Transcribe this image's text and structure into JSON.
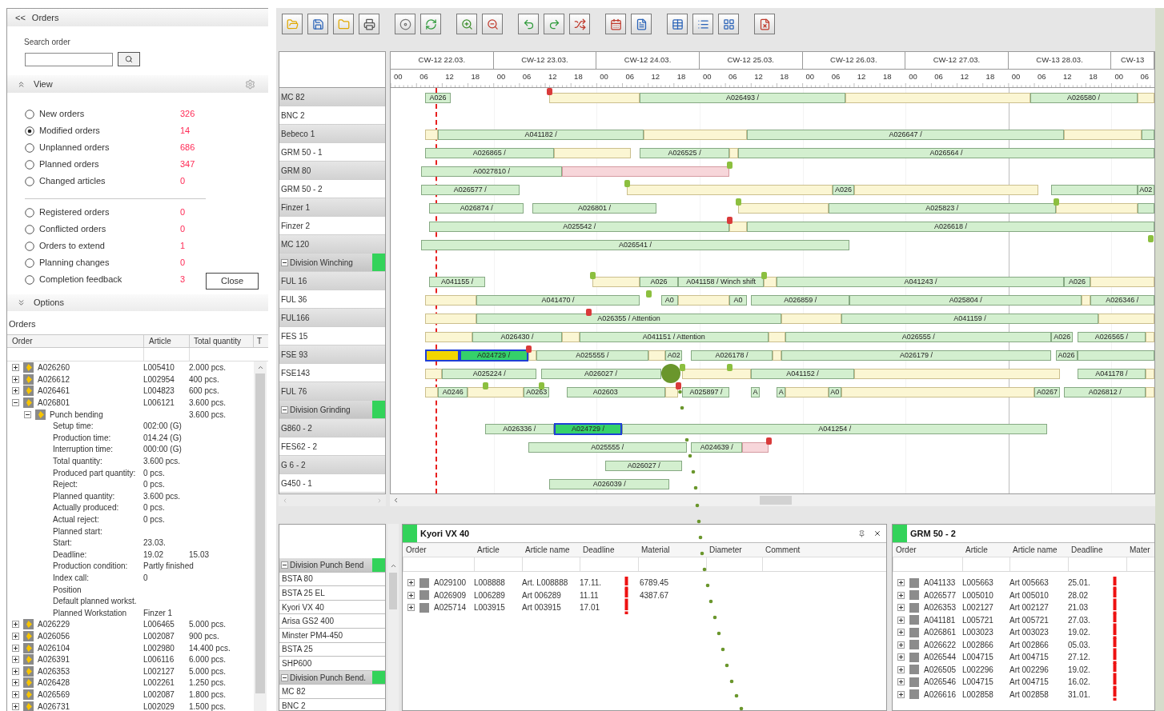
{
  "orders_panel": {
    "collapse": "<<",
    "title": "Orders",
    "search_label": "Search order",
    "view_title": "View",
    "filters": [
      {
        "label": "New orders",
        "count": "326",
        "selected": false
      },
      {
        "label": "Modified orders",
        "count": "14",
        "selected": true
      },
      {
        "label": "Unplanned orders",
        "count": "686",
        "selected": false
      },
      {
        "label": "Planned orders",
        "count": "347",
        "selected": false
      },
      {
        "label": "Changed articles",
        "count": "0",
        "selected": false
      }
    ],
    "more_filters": [
      {
        "label": "Registered orders",
        "count": "0",
        "selected": false
      },
      {
        "label": "Conflicted orders",
        "count": "0",
        "selected": false
      },
      {
        "label": "Orders to extend",
        "count": "1",
        "selected": false
      },
      {
        "label": "Planning changes",
        "count": "0",
        "selected": false
      },
      {
        "label": "Completion feedback",
        "count": "3",
        "selected": false
      }
    ],
    "close_button": "Close",
    "options_title": "Options",
    "orders_title": "Orders",
    "columns": [
      "Order",
      "Article",
      "Total quantity",
      "T"
    ],
    "orders": [
      {
        "order": "A026260",
        "article": "L005410",
        "quantity": "2.000 pcs.",
        "expanded": false
      },
      {
        "order": "A026612",
        "article": "L002954",
        "quantity": "400 pcs.",
        "expanded": false
      },
      {
        "order": "A026461",
        "article": "L004823",
        "quantity": "600 pcs.",
        "expanded": false
      },
      {
        "order": "A026801",
        "article": "L006121",
        "quantity": "3.600 pcs.",
        "expanded": true,
        "operations": [
          {
            "name": "Punch bending",
            "quantity": "3.600 pcs.",
            "expanded": true,
            "details": [
              {
                "label": "Setup time:",
                "values": [
                  "002:00 (G)"
                ]
              },
              {
                "label": "Production time:",
                "values": [
                  "014.24 (G)"
                ]
              },
              {
                "label": "Interruption time:",
                "values": [
                  "000:00 (G)"
                ]
              },
              {
                "label": "Total quantity:",
                "values": [
                  "3.600 pcs."
                ]
              },
              {
                "label": "Produced part quantity:",
                "values": [
                  "0 pcs."
                ]
              },
              {
                "label": "Reject:",
                "values": [
                  "0 pcs."
                ]
              },
              {
                "label": "Planned quantity:",
                "values": [
                  "3.600 pcs."
                ]
              },
              {
                "label": "Actually produced:",
                "values": [
                  "0 pcs."
                ]
              },
              {
                "label": "Actual reject:",
                "values": [
                  "0 pcs."
                ]
              },
              {
                "label": "Planned start:"
              },
              {
                "label": "Start:",
                "values": [
                  "23.03."
                ]
              },
              {
                "label": "Deadline:",
                "values": [
                  "19.02",
                  "15.03"
                ]
              },
              {
                "label": "Production condition:",
                "values": [
                  "Partly finished"
                ]
              },
              {
                "label": "Index call:",
                "values": [
                  "0"
                ]
              },
              {
                "label": "Position"
              },
              {
                "label": "Default planned workst."
              },
              {
                "label": "Planned Workstation",
                "values": [
                  "Finzer 1"
                ]
              }
            ]
          }
        ]
      },
      {
        "order": "A026229",
        "article": "L006465",
        "quantity": "5.000 pcs.",
        "expanded": false
      },
      {
        "order": "A026056",
        "article": "L002087",
        "quantity": "900 pcs.",
        "expanded": false
      },
      {
        "order": "A026104",
        "article": "L002980",
        "quantity": "14.400 pcs.",
        "expanded": false
      },
      {
        "order": "A026391",
        "article": "L006116",
        "quantity": "6.000 pcs.",
        "expanded": false
      },
      {
        "order": "A026353",
        "article": "L002127",
        "quantity": "5.000 pcs.",
        "expanded": false
      },
      {
        "order": "A026428",
        "article": "L002261",
        "quantity": "1.250 pcs.",
        "expanded": false
      },
      {
        "order": "A026569",
        "article": "L002087",
        "quantity": "1.800 pcs.",
        "expanded": false
      },
      {
        "order": "A026731",
        "article": "L002029",
        "quantity": "1.500 pcs.",
        "expanded": false
      }
    ]
  },
  "gantt": {
    "days": [
      {
        "week": "CW-12 22.03.",
        "hours": [
          "00",
          "06",
          "12",
          "18"
        ]
      },
      {
        "week": "CW-12 23.03.",
        "hours": [
          "00",
          "06",
          "12",
          "18"
        ]
      },
      {
        "week": "CW-12 24.03.",
        "hours": [
          "00",
          "06",
          "12",
          "18"
        ]
      },
      {
        "week": "CW-12 25.03.",
        "hours": [
          "00",
          "06",
          "12",
          "18"
        ]
      },
      {
        "week": "CW-12 26.03.",
        "hours": [
          "00",
          "06",
          "12",
          "18"
        ]
      },
      {
        "week": "CW-12 27.03.",
        "hours": [
          "00",
          "06",
          "12",
          "18"
        ]
      },
      {
        "week": "CW-13 28.03.",
        "hours": [
          "00",
          "06",
          "12",
          "18"
        ]
      },
      {
        "week": "CW-13",
        "hours": [
          "00",
          "06"
        ]
      }
    ],
    "rows": [
      {
        "kind": "resource",
        "name": "MC 82",
        "flags": [
          {
            "color": "#d93a3a"
          }
        ],
        "bars": [
          {
            "label": "A026",
            "kind": "planned"
          },
          {
            "kind": "buffer"
          },
          {
            "label": "A026493 /",
            "kind": "planned"
          },
          {
            "kind": "buffer"
          },
          {
            "label": "A026580 /",
            "kind": "planned"
          },
          {
            "kind": "buffer"
          }
        ]
      },
      {
        "kind": "resource",
        "name": "BNC 2"
      },
      {
        "kind": "resource",
        "name": "Bebeco 1",
        "bars": [
          {
            "kind": "buffer"
          },
          {
            "label": "A041182 /",
            "kind": "planned"
          },
          {
            "kind": "buffer"
          },
          {
            "label": "A026647 /",
            "kind": "planned"
          },
          {
            "kind": "buffer"
          },
          {
            "kind": "planned"
          }
        ]
      },
      {
        "kind": "resource",
        "name": "GRM 50 - 1",
        "bars": [
          {
            "label": "A026865 /",
            "kind": "planned"
          },
          {
            "kind": "buffer"
          },
          {
            "label": "A026525 /",
            "kind": "planned"
          },
          {
            "kind": "buffer"
          },
          {
            "label": "A026564 /",
            "kind": "planned"
          }
        ]
      },
      {
        "kind": "resource",
        "name": "GRM 80",
        "flags": [
          {
            "color": "#8cbf3f"
          }
        ],
        "bars": [
          {
            "label": "A0027810 /",
            "kind": "planned"
          },
          {
            "kind": "late"
          }
        ]
      },
      {
        "kind": "resource",
        "name": "GRM 50 - 2",
        "flags": [
          {
            "color": "#8cbf3f"
          }
        ],
        "bars": [
          {
            "label": "A026577 /",
            "kind": "planned"
          },
          {
            "kind": "buffer"
          },
          {
            "label": "A026",
            "kind": "planned"
          },
          {
            "kind": "buffer"
          },
          {
            "kind": "planned"
          },
          {
            "label": "A02",
            "kind": "planned"
          }
        ]
      },
      {
        "kind": "resource",
        "name": "Finzer 1",
        "flags": [
          {
            "color": "#8cbf3f"
          },
          {
            "color": "#8cbf3f"
          }
        ],
        "bars": [
          {
            "label": "A026874 /",
            "kind": "planned"
          },
          {
            "label": "A026801 /",
            "kind": "planned"
          },
          {
            "kind": "buffer"
          },
          {
            "label": "A025823 /",
            "kind": "planned"
          },
          {
            "kind": "buffer"
          },
          {
            "kind": "planned"
          }
        ]
      },
      {
        "kind": "resource",
        "name": "Finzer 2",
        "flags": [
          {
            "color": "#d93a3a"
          }
        ],
        "bars": [
          {
            "label": "A025542 /",
            "kind": "planned"
          },
          {
            "kind": "buffer"
          },
          {
            "label": "A026618 /",
            "kind": "planned"
          }
        ]
      },
      {
        "kind": "resource",
        "name": "MC 120",
        "flags": [
          {
            "color": "#8cbf3f"
          }
        ],
        "bars": [
          {
            "label": "A026541 /",
            "kind": "planned"
          }
        ]
      },
      {
        "kind": "group",
        "name": "Division Winching",
        "expanded": true
      },
      {
        "kind": "resource",
        "name": "FUL 16",
        "flags": [
          {
            "color": "#8cbf3f"
          },
          {
            "color": "#8cbf3f"
          }
        ],
        "bars": [
          {
            "label": "A041155 /",
            "kind": "planned"
          },
          {
            "kind": "buffer"
          },
          {
            "label": "A026",
            "kind": "planned"
          },
          {
            "label": "A041158 / Winch shift",
            "kind": "planned"
          },
          {
            "kind": "buffer"
          },
          {
            "label": "A041243 /",
            "kind": "planned"
          },
          {
            "label": "A026",
            "kind": "planned"
          },
          {
            "kind": "buffer"
          }
        ]
      },
      {
        "kind": "resource",
        "name": "FUL 36",
        "flags": [
          {
            "color": "#8cbf3f"
          }
        ],
        "bars": [
          {
            "kind": "buffer"
          },
          {
            "label": "A041470 /",
            "kind": "planned"
          },
          {
            "label": "A0",
            "kind": "planned"
          },
          {
            "kind": "buffer"
          },
          {
            "label": "A0",
            "kind": "planned"
          },
          {
            "label": "A026859 /",
            "kind": "planned"
          },
          {
            "label": "A025804 /",
            "kind": "planned"
          },
          {
            "kind": "buffer"
          },
          {
            "label": "A026346 /",
            "kind": "planned"
          }
        ]
      },
      {
        "kind": "resource",
        "name": "FUL166",
        "flags": [
          {
            "color": "#d93a3a"
          }
        ],
        "bars": [
          {
            "kind": "buffer"
          },
          {
            "label": "A026355 / Attention",
            "kind": "planned"
          },
          {
            "kind": "buffer"
          },
          {
            "label": "A041159 /",
            "kind": "planned"
          },
          {
            "kind": "buffer"
          }
        ]
      },
      {
        "kind": "resource",
        "name": "FES 15",
        "bars": [
          {
            "kind": "buffer"
          },
          {
            "label": "A026430 /",
            "kind": "planned"
          },
          {
            "kind": "buffer"
          },
          {
            "label": "A041151 / Attention",
            "kind": "planned"
          },
          {
            "kind": "buffer"
          },
          {
            "label": "A026555 /",
            "kind": "planned"
          },
          {
            "label": "A026",
            "kind": "planned"
          },
          {
            "label": "A026565 /",
            "kind": "planned"
          },
          {
            "kind": "buffer"
          }
        ]
      },
      {
        "kind": "resource",
        "name": "FSE 93",
        "flags": [
          {
            "color": "#d93a3a"
          }
        ],
        "bars": [
          {
            "kind": "done"
          },
          {
            "label": "A024729 /",
            "kind": "selected"
          },
          {
            "kind": "buffer"
          },
          {
            "label": "A025555 /",
            "kind": "planned"
          },
          {
            "kind": "buffer"
          },
          {
            "label": "A02",
            "kind": "planned"
          },
          {
            "label": "A026178 /",
            "kind": "planned"
          },
          {
            "kind": "buffer"
          },
          {
            "label": "A026179 /",
            "kind": "planned"
          },
          {
            "label": "A026",
            "kind": "planned"
          },
          {
            "kind": "planned"
          }
        ]
      },
      {
        "kind": "resource",
        "name": "FSE143",
        "flags": [
          {
            "color": "#8cbf3f"
          },
          {
            "color": "#8cbf3f"
          }
        ],
        "bars": [
          {
            "kind": "buffer"
          },
          {
            "label": "A025224 /",
            "kind": "planned"
          },
          {
            "label": "A026027 /",
            "kind": "planned"
          },
          {
            "kind": "buffer"
          },
          {
            "label": "A041152 /",
            "kind": "planned"
          },
          {
            "kind": "buffer"
          },
          {
            "label": "A041178 /",
            "kind": "planned"
          },
          {
            "kind": "buffer"
          }
        ]
      },
      {
        "kind": "resource",
        "name": "FUL 76",
        "flags": [
          {
            "color": "#8cbf3f"
          },
          {
            "color": "#8cbf3f"
          },
          {
            "color": "#d93a3a"
          }
        ],
        "bars": [
          {
            "kind": "buffer"
          },
          {
            "label": "A0246",
            "kind": "planned"
          },
          {
            "kind": "buffer"
          },
          {
            "label": "A0263",
            "kind": "planned"
          },
          {
            "label": "A02603",
            "kind": "planned"
          },
          {
            "kind": "buffer"
          },
          {
            "label": "A025897 /",
            "kind": "planned"
          },
          {
            "label": "A",
            "kind": "planned"
          },
          {
            "label": "A",
            "kind": "planned"
          },
          {
            "kind": "buffer"
          },
          {
            "label": "A0",
            "kind": "planned"
          },
          {
            "kind": "buffer"
          },
          {
            "label": "A0267",
            "kind": "planned"
          },
          {
            "label": "A026812 /",
            "kind": "planned"
          },
          {
            "kind": "buffer"
          }
        ]
      },
      {
        "kind": "group",
        "name": "Division Grinding",
        "expanded": true
      },
      {
        "kind": "resource",
        "name": "G860 - 2",
        "bars": [
          {
            "label": "A026336 /",
            "kind": "planned"
          },
          {
            "label": "A024729 /",
            "kind": "selected"
          },
          {
            "label": "A041254 /",
            "kind": "planned"
          }
        ]
      },
      {
        "kind": "resource",
        "name": "FES62 - 2",
        "flags": [
          {
            "color": "#d93a3a"
          }
        ],
        "bars": [
          {
            "label": "A025555 /",
            "kind": "planned"
          },
          {
            "label": "A024639 /",
            "kind": "planned"
          },
          {
            "kind": "late"
          }
        ]
      },
      {
        "kind": "resource",
        "name": "G 6 - 2",
        "bars": [
          {
            "label": "A026027 /",
            "kind": "planned"
          }
        ]
      },
      {
        "kind": "resource",
        "name": "G450 - 1",
        "bars": [
          {
            "label": "A026039 /",
            "kind": "planned"
          }
        ]
      }
    ]
  },
  "resource_list": [
    {
      "kind": "group",
      "name": "Division Punch Bend",
      "expanded": true
    },
    {
      "kind": "resource",
      "name": "BSTA 80"
    },
    {
      "kind": "resource",
      "name": "BSTA 25 EL"
    },
    {
      "kind": "resource",
      "name": "Kyori VX 40"
    },
    {
      "kind": "resource",
      "name": "Arisa GS2 400"
    },
    {
      "kind": "resource",
      "name": "Minster PM4-450"
    },
    {
      "kind": "resource",
      "name": "BSTA 25"
    },
    {
      "kind": "resource",
      "name": "SHP600"
    },
    {
      "kind": "group",
      "name": "Division Punch Bend.",
      "expanded": true
    },
    {
      "kind": "resource",
      "name": "MC 82"
    },
    {
      "kind": "resource",
      "name": "BNC 2"
    }
  ],
  "panels": [
    {
      "title": "Kyori VX 40",
      "columns": [
        "Order",
        "Article",
        "Article name",
        "Deadline",
        "Material",
        "Diameter",
        "Comment"
      ],
      "rows": [
        {
          "order": "A029100",
          "article": "L008888",
          "article_name": "Art. L008888",
          "deadline": "17.11.",
          "overdue": true,
          "material": "6789.45",
          "expanded": false
        },
        {
          "order": "A026909",
          "article": "L006289",
          "article_name": "Art 006289",
          "deadline": "11.11",
          "overdue": true,
          "material": "4387.67",
          "expanded": false
        },
        {
          "order": "A025714",
          "article": "L003915",
          "article_name": "Art 003915",
          "deadline": "17.01",
          "overdue": true,
          "expanded": false
        }
      ]
    },
    {
      "title": "GRM 50 - 2",
      "columns": [
        "Order",
        "Article",
        "Article name",
        "Deadline",
        "Mater"
      ],
      "rows": [
        {
          "order": "A041133",
          "article": "L005663",
          "article_name": "Art 005663",
          "deadline": "25.01.",
          "overdue": true,
          "expanded": false
        },
        {
          "order": "A026577",
          "article": "L005010",
          "article_name": "Art 005010",
          "deadline": "28.02",
          "overdue": true,
          "expanded": false
        },
        {
          "order": "A026353",
          "article": "L002127",
          "article_name": "Art 002127",
          "deadline": "21.03",
          "overdue": true,
          "expanded": false
        },
        {
          "order": "A041181",
          "article": "L005721",
          "article_name": "Art 005721",
          "deadline": "27.03.",
          "overdue": true,
          "expanded": false
        },
        {
          "order": "A026861",
          "article": "L003023",
          "article_name": "Art 003023",
          "deadline": "19.02.",
          "overdue": true,
          "expanded": false
        },
        {
          "order": "A026622",
          "article": "L002866",
          "article_name": "Art 002866",
          "deadline": "05.03.",
          "overdue": true,
          "expanded": false
        },
        {
          "order": "A026544",
          "article": "L004715",
          "article_name": "Art 004715",
          "deadline": "27.12.",
          "overdue": true,
          "expanded": false
        },
        {
          "order": "A026505",
          "article": "L002296",
          "article_name": "Art 002296",
          "deadline": "19.02.",
          "overdue": true,
          "expanded": false
        },
        {
          "order": "A026546",
          "article": "L004715",
          "article_name": "Art 004715",
          "deadline": "16.02.",
          "overdue": true,
          "expanded": false
        },
        {
          "order": "A026616",
          "article": "L002858",
          "article_name": "Art 002858",
          "deadline": "31.01.",
          "overdue": true,
          "expanded": false
        }
      ]
    }
  ]
}
